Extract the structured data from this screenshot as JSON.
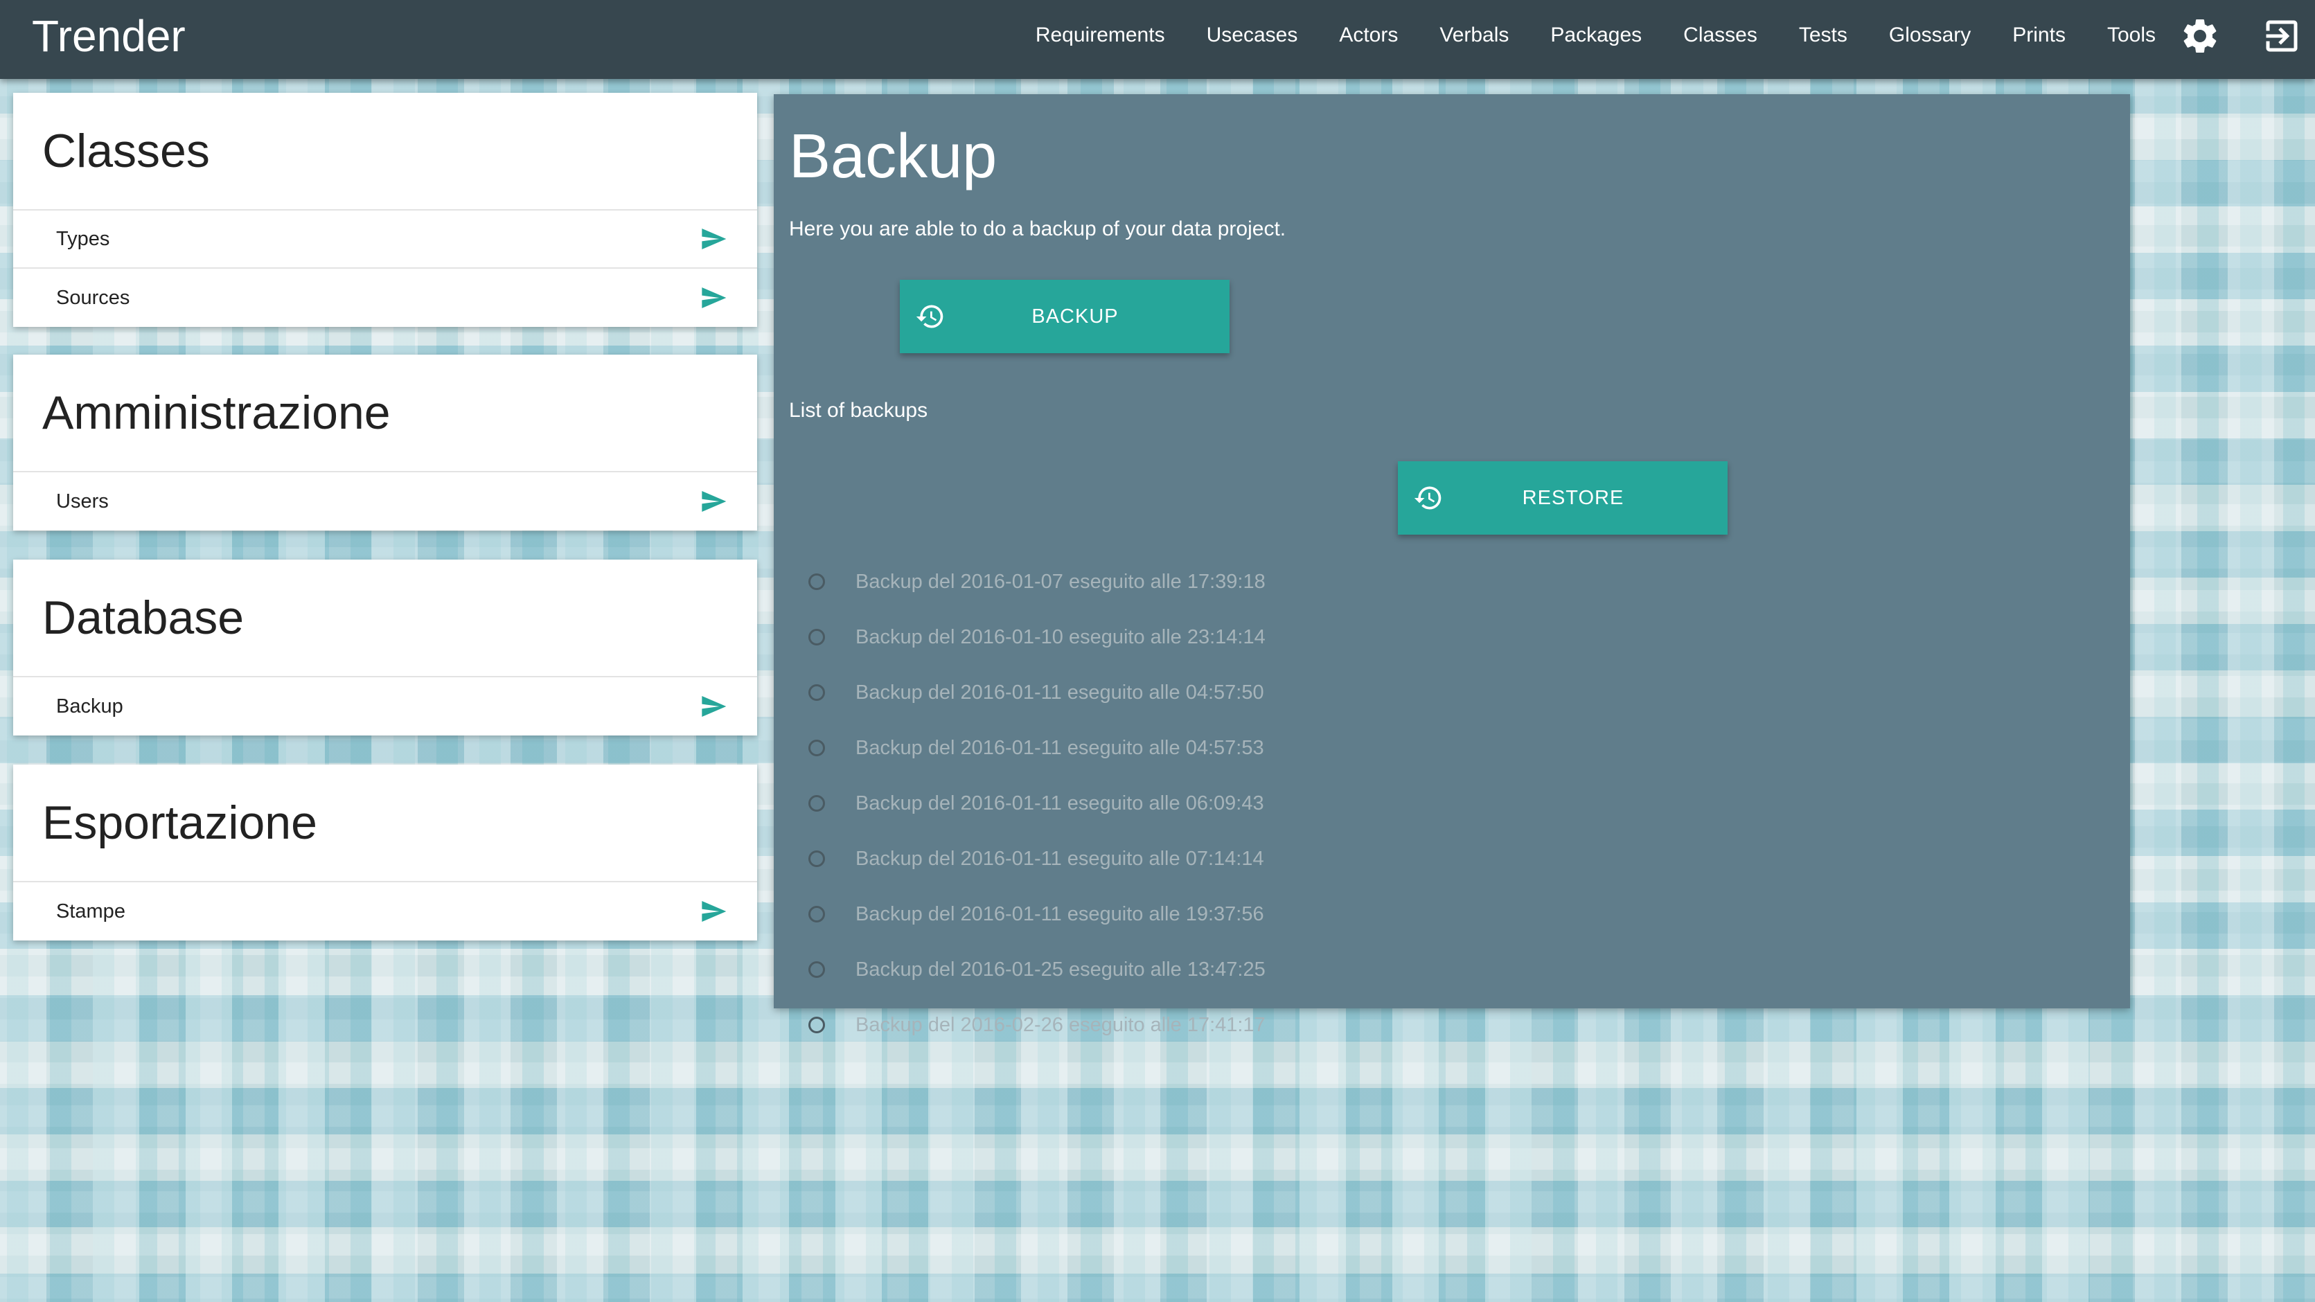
{
  "app": {
    "brand": "Trender"
  },
  "nav": {
    "links": [
      "Requirements",
      "Usecases",
      "Actors",
      "Verbals",
      "Packages",
      "Classes",
      "Tests",
      "Glossary",
      "Prints",
      "Tools"
    ],
    "settings_icon": "gear-icon",
    "logout_icon": "logout-icon"
  },
  "sidebar": {
    "cards": [
      {
        "title": "Classes",
        "items": [
          {
            "label": "Types",
            "icon": "send-icon"
          },
          {
            "label": "Sources",
            "icon": "send-icon"
          }
        ]
      },
      {
        "title": "Amministrazione",
        "items": [
          {
            "label": "Users",
            "icon": "send-icon"
          }
        ]
      },
      {
        "title": "Database",
        "items": [
          {
            "label": "Backup",
            "icon": "send-icon"
          }
        ]
      },
      {
        "title": "Esportazione",
        "items": [
          {
            "label": "Stampe",
            "icon": "send-icon"
          }
        ]
      }
    ],
    "accent_color": "#26a69a"
  },
  "main": {
    "title": "Backup",
    "description": "Here you are able to do a backup of your data project.",
    "backup_button": {
      "label": "BACKUP",
      "icon": "history-icon"
    },
    "restore_button": {
      "label": "RESTORE",
      "icon": "history-icon"
    },
    "list_title": "List of backups",
    "backups": [
      "Backup del 2016-01-07 eseguito alle 17:39:18",
      "Backup del 2016-01-10 eseguito alle 23:14:14",
      "Backup del 2016-01-11 eseguito alle 04:57:50",
      "Backup del 2016-01-11 eseguito alle 04:57:53",
      "Backup del 2016-01-11 eseguito alle 06:09:43",
      "Backup del 2016-01-11 eseguito alle 07:14:14",
      "Backup del 2016-01-11 eseguito alle 19:37:56",
      "Backup del 2016-01-25 eseguito alle 13:47:25",
      "Backup del 2016-02-26 eseguito alle 17:41:17"
    ],
    "panel_color": "#607d8b",
    "button_color": "#26a69a"
  }
}
